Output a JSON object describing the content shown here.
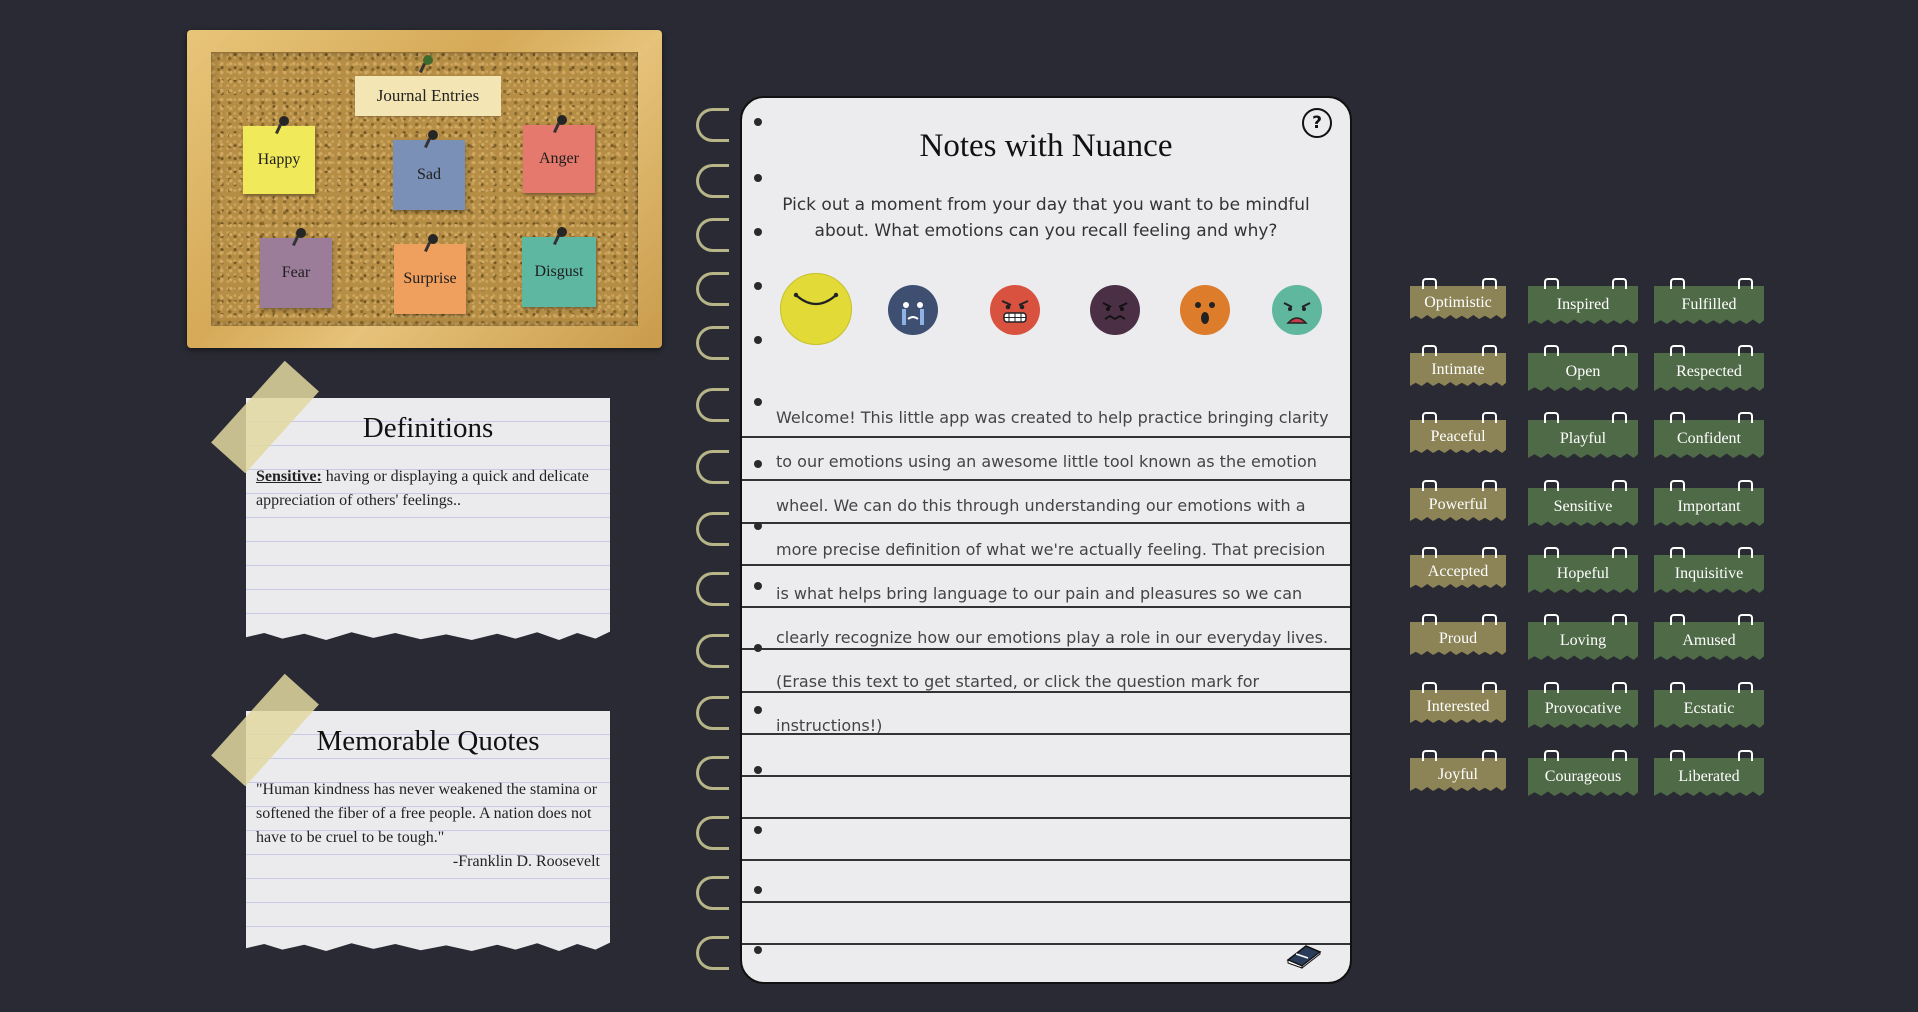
{
  "corkboard": {
    "title": "Journal Entries",
    "notes": [
      {
        "label": "Happy",
        "color": "#f0e95a"
      },
      {
        "label": "Sad",
        "color": "#7a90b6"
      },
      {
        "label": "Anger",
        "color": "#e5796d"
      },
      {
        "label": "Fear",
        "color": "#9b7d99"
      },
      {
        "label": "Surprise",
        "color": "#f0a05e"
      },
      {
        "label": "Disgust",
        "color": "#5eb8a1"
      }
    ]
  },
  "definitions": {
    "title": "Definitions",
    "term": "Sensitive:",
    "definition": " having or displaying a quick and delicate appreciation of others' feelings.."
  },
  "quotes": {
    "title": "Memorable Quotes",
    "quote": "\"Human kindness has never weakened the stamina or softened the fiber of a free people. A nation does not have to be cruel to be tough.\"",
    "author": "-Franklin D. Roosevelt"
  },
  "notebook": {
    "title": "Notes with Nuance",
    "help_icon": "question-circle-icon",
    "prompt": "Pick out a moment from your day that you want to be mindful about. What emotions can you recall feeling and why?",
    "faces": [
      {
        "name": "happy-face-icon",
        "color": "#e1da37"
      },
      {
        "name": "sad-face-icon",
        "color": "#3e4f72"
      },
      {
        "name": "angry-face-icon",
        "color": "#d9523f"
      },
      {
        "name": "fear-face-icon",
        "color": "#4b2f45"
      },
      {
        "name": "surprise-face-icon",
        "color": "#dd7c2a"
      },
      {
        "name": "disgust-face-icon",
        "color": "#5fb79e"
      }
    ],
    "body": "Welcome! This little app was created to help practice bringing clarity to our emotions using an awesome little tool known as the emotion wheel. We can do this through understanding our emotions with a more precise definition of what we're actually feeling. That precision is what helps bring language to our pain and pleasures so we can clearly recognize how our emotions play a role in our everyday lives. (Erase this text to get started, or click the question mark for instructions!)",
    "book_icon": "book-icon"
  },
  "emotion_tags": {
    "column1": [
      "Optimistic",
      "Intimate",
      "Peaceful",
      "Powerful",
      "Accepted",
      "Proud",
      "Interested",
      "Joyful"
    ],
    "column2": [
      "Inspired",
      "Open",
      "Playful",
      "Sensitive",
      "Hopeful",
      "Loving",
      "Provocative",
      "Courageous"
    ],
    "column3": [
      "Fulfilled",
      "Respected",
      "Confident",
      "Important",
      "Inquisitive",
      "Amused",
      "Ecstatic",
      "Liberated"
    ]
  }
}
